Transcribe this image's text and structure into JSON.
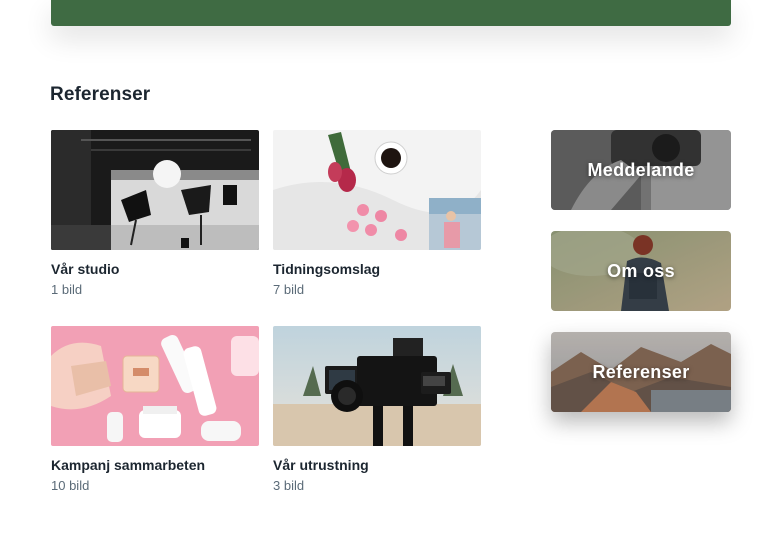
{
  "section": {
    "title": "Referenser"
  },
  "albums": [
    {
      "name": "Vår studio",
      "count": "1 bild"
    },
    {
      "name": "Tidningsomslag",
      "count": "7 bild"
    },
    {
      "name": "Kampanj sammarbeten",
      "count": "10 bild"
    },
    {
      "name": "Vår utrustning",
      "count": "3 bild"
    }
  ],
  "nav_tiles": [
    {
      "label": "Meddelande"
    },
    {
      "label": "Om oss"
    },
    {
      "label": "Referenser",
      "active": true
    }
  ],
  "colors": {
    "topbar": "#3f6b43",
    "text": "#1c2630",
    "muted": "#5b6b78"
  }
}
